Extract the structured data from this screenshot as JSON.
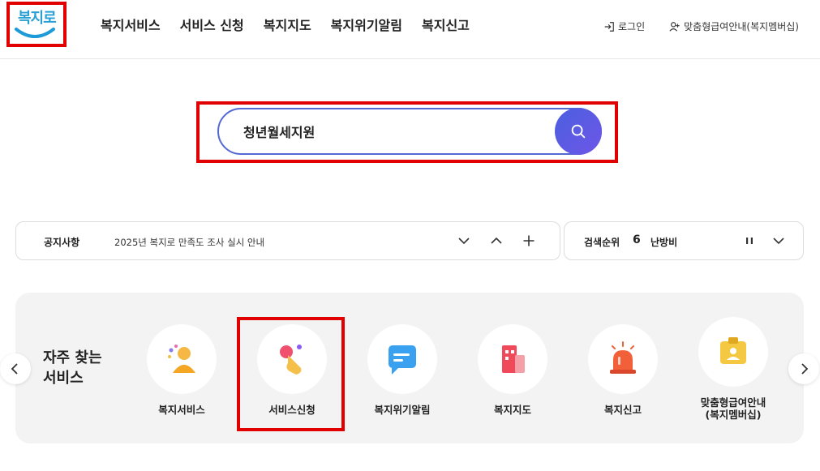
{
  "header": {
    "logo_text": "복지로",
    "nav": [
      "복지서비스",
      "서비스 신청",
      "복지지도",
      "복지위기알림",
      "복지신고"
    ],
    "login": "로그인",
    "membership": "맞춤형급여안내(복지멤버십)"
  },
  "search": {
    "value": "청년월세지원"
  },
  "notice": {
    "label": "공지사항",
    "text": "2025년 복지로 만족도 조사 실시 안내"
  },
  "rank": {
    "label": "검색순위",
    "number": "6",
    "word": "난방비"
  },
  "services": {
    "title_line1": "자주 찾는",
    "title_line2": "서비스",
    "items": [
      {
        "label": "복지서비스"
      },
      {
        "label": "서비스신청"
      },
      {
        "label": "복지위기알림"
      },
      {
        "label": "복지지도"
      },
      {
        "label": "복지신고"
      },
      {
        "label_line1": "맞춤형급여안내",
        "label_line2": "(복지멤버십)"
      }
    ]
  },
  "colors": {
    "accent": "#5468d4",
    "highlight": "#e00000"
  }
}
